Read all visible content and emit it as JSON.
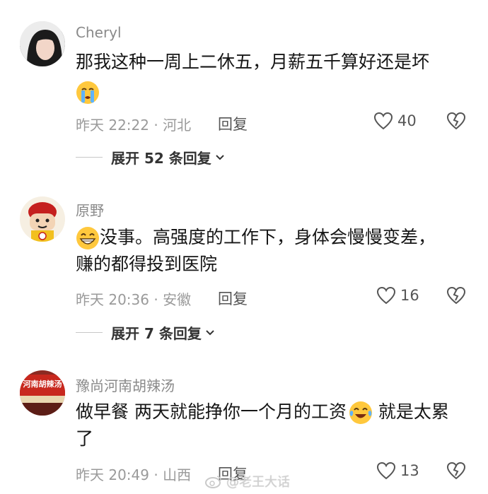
{
  "comments": [
    {
      "username": "Cheryl",
      "text_line1": "那我这种一周上二休五，月薪五千算好还是坏",
      "emoji": "loudly-crying-emoji",
      "time_location": "昨天 22:22 · 河北",
      "reply_label": "回复",
      "likes": "40",
      "expand_label": "展开 52 条回复"
    },
    {
      "username": "原野",
      "emoji": "grinning-emoji",
      "text_line1": "没事。高强度的工作下，身体会慢慢变差，",
      "text_line2": "赚的都得投到医院",
      "time_location": "昨天 20:36 · 安徽",
      "reply_label": "回复",
      "likes": "16",
      "expand_label": "展开 7 条回复"
    },
    {
      "username": "豫尚河南胡辣汤",
      "avatar_sign_text": "河南胡辣汤",
      "text_before_emoji": "做早餐 两天就能挣你一个月的工资",
      "emoji": "tears-of-joy-emoji",
      "text_after_emoji": " 就是太累",
      "text_line2": "了",
      "time_location": "昨天 20:49 · 山西",
      "reply_label": "回复",
      "likes": "13"
    }
  ],
  "watermark": "@老王大话",
  "colors": {
    "meta": "#9a9a9a",
    "name": "#8a8a8a",
    "text": "#161616",
    "emoji": "#ffc83d"
  }
}
